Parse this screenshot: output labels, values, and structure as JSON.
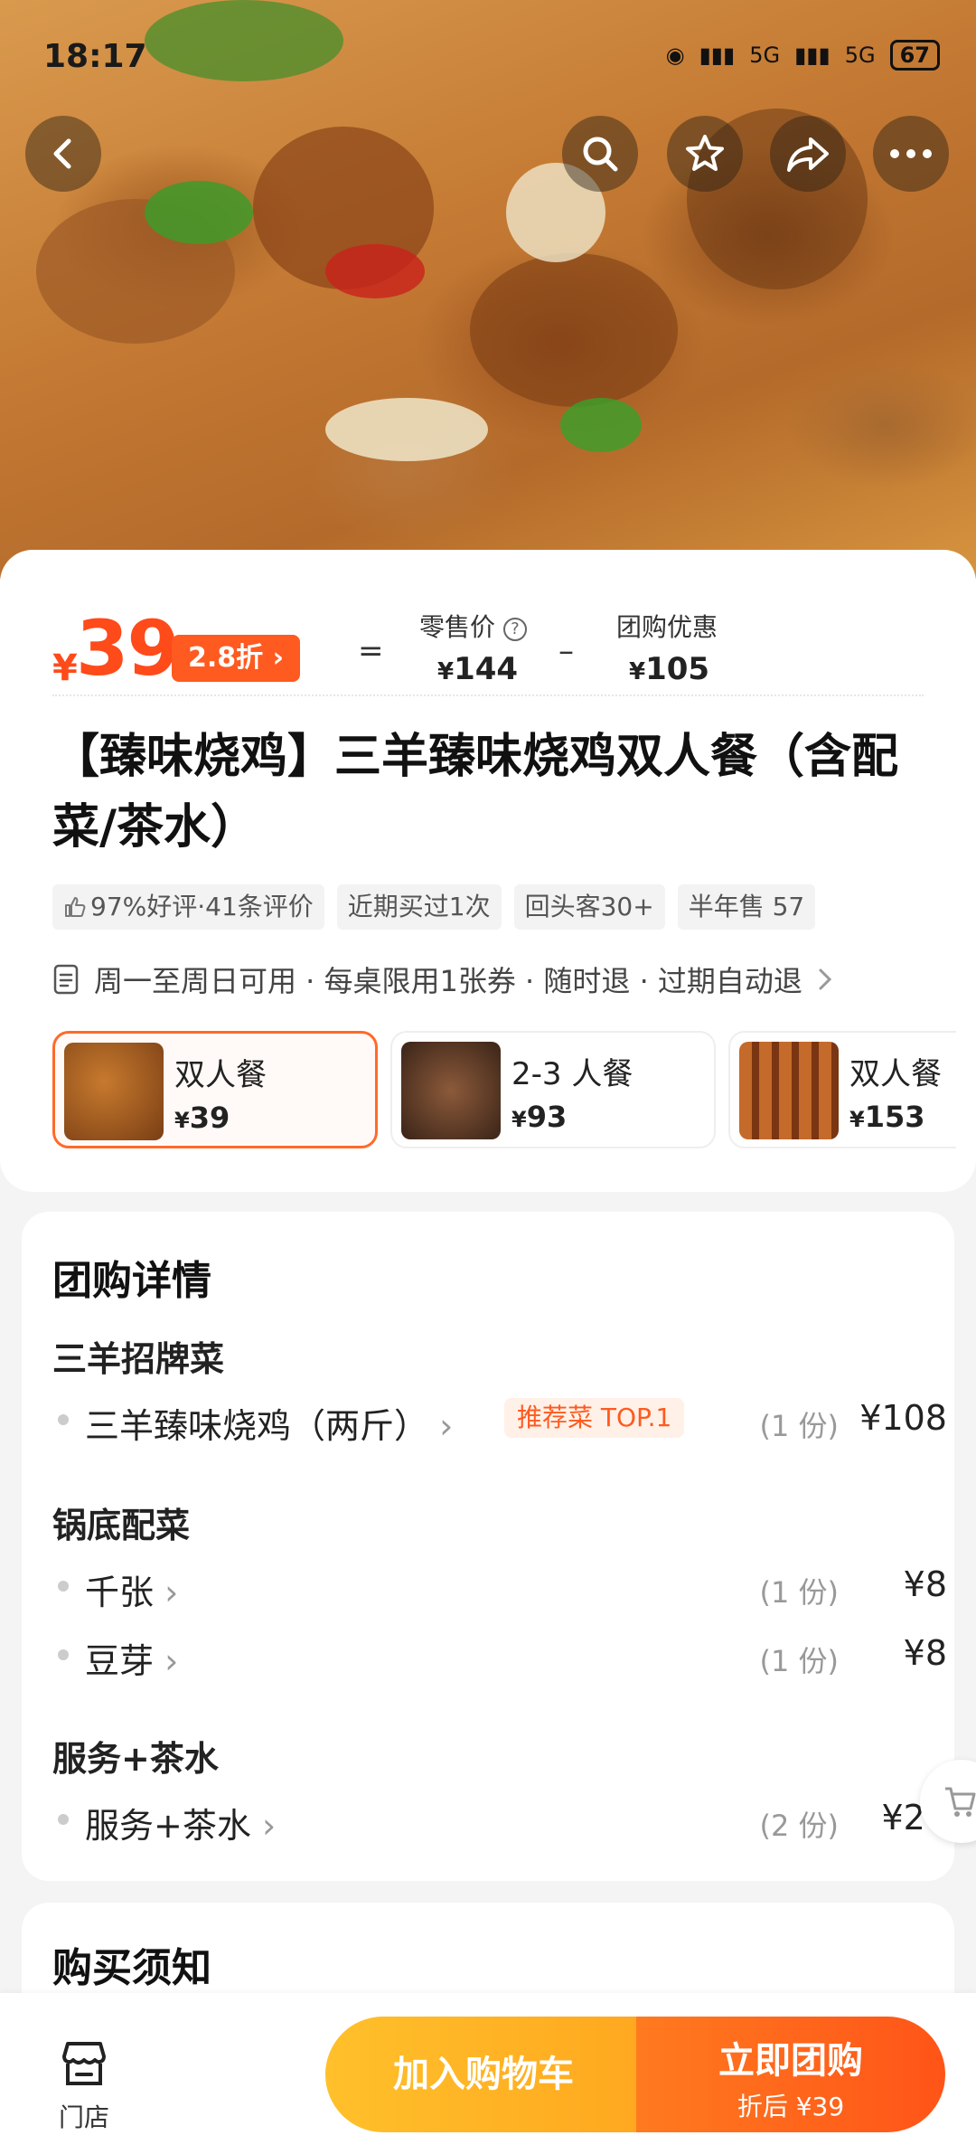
{
  "status": {
    "time": "18:17",
    "battery": "67",
    "net1": "5G",
    "net2": "5G"
  },
  "nav": {
    "back": "back",
    "search": "search",
    "favorite": "favorite",
    "share": "share",
    "more": "more"
  },
  "price": {
    "currency": "¥",
    "current": "39",
    "discount": "2.8折 ›",
    "eq": "=",
    "minus": "–",
    "retail_label": "零售价",
    "retail_value": "144",
    "group_label": "团购优惠",
    "group_value": "105"
  },
  "title": "【臻味烧鸡】三羊臻味烧鸡双人餐（含配菜/茶水）",
  "tags": [
    "97%好评·41条评价",
    "近期买过1次",
    "回头客30+",
    "半年售 57"
  ],
  "rules": "周一至周日可用 · 每桌限用1张券 · 随时退 · 过期自动退",
  "packages": [
    {
      "name": "双人餐",
      "price": "39"
    },
    {
      "name": "2-3 人餐",
      "price": "93"
    },
    {
      "name": "双人餐",
      "price": "153"
    }
  ],
  "details": {
    "title": "团购详情",
    "groups": [
      {
        "title": "三羊招牌菜",
        "items": [
          {
            "name": "三羊臻味烧鸡（两斤）",
            "tag": "推荐菜 TOP.1",
            "qty": "(1 份)",
            "amount": "¥108"
          }
        ]
      },
      {
        "title": "锅底配菜",
        "items": [
          {
            "name": "千张",
            "qty": "(1 份)",
            "amount": "¥8"
          },
          {
            "name": "豆芽",
            "qty": "(1 份)",
            "amount": "¥8"
          }
        ]
      },
      {
        "title": "服务+茶水",
        "items": [
          {
            "name": "服务+茶水",
            "qty": "(2 份)",
            "amount": "¥20"
          }
        ]
      }
    ]
  },
  "notice": {
    "title": "购买须知"
  },
  "bottom": {
    "shop_label": "门店",
    "cart_label": "加入购物车",
    "buy_label": "立即团购",
    "buy_sub": "折后 ¥39"
  },
  "colors": {
    "accent": "#ff5a1f",
    "cart_yellow": "#ffb526"
  }
}
